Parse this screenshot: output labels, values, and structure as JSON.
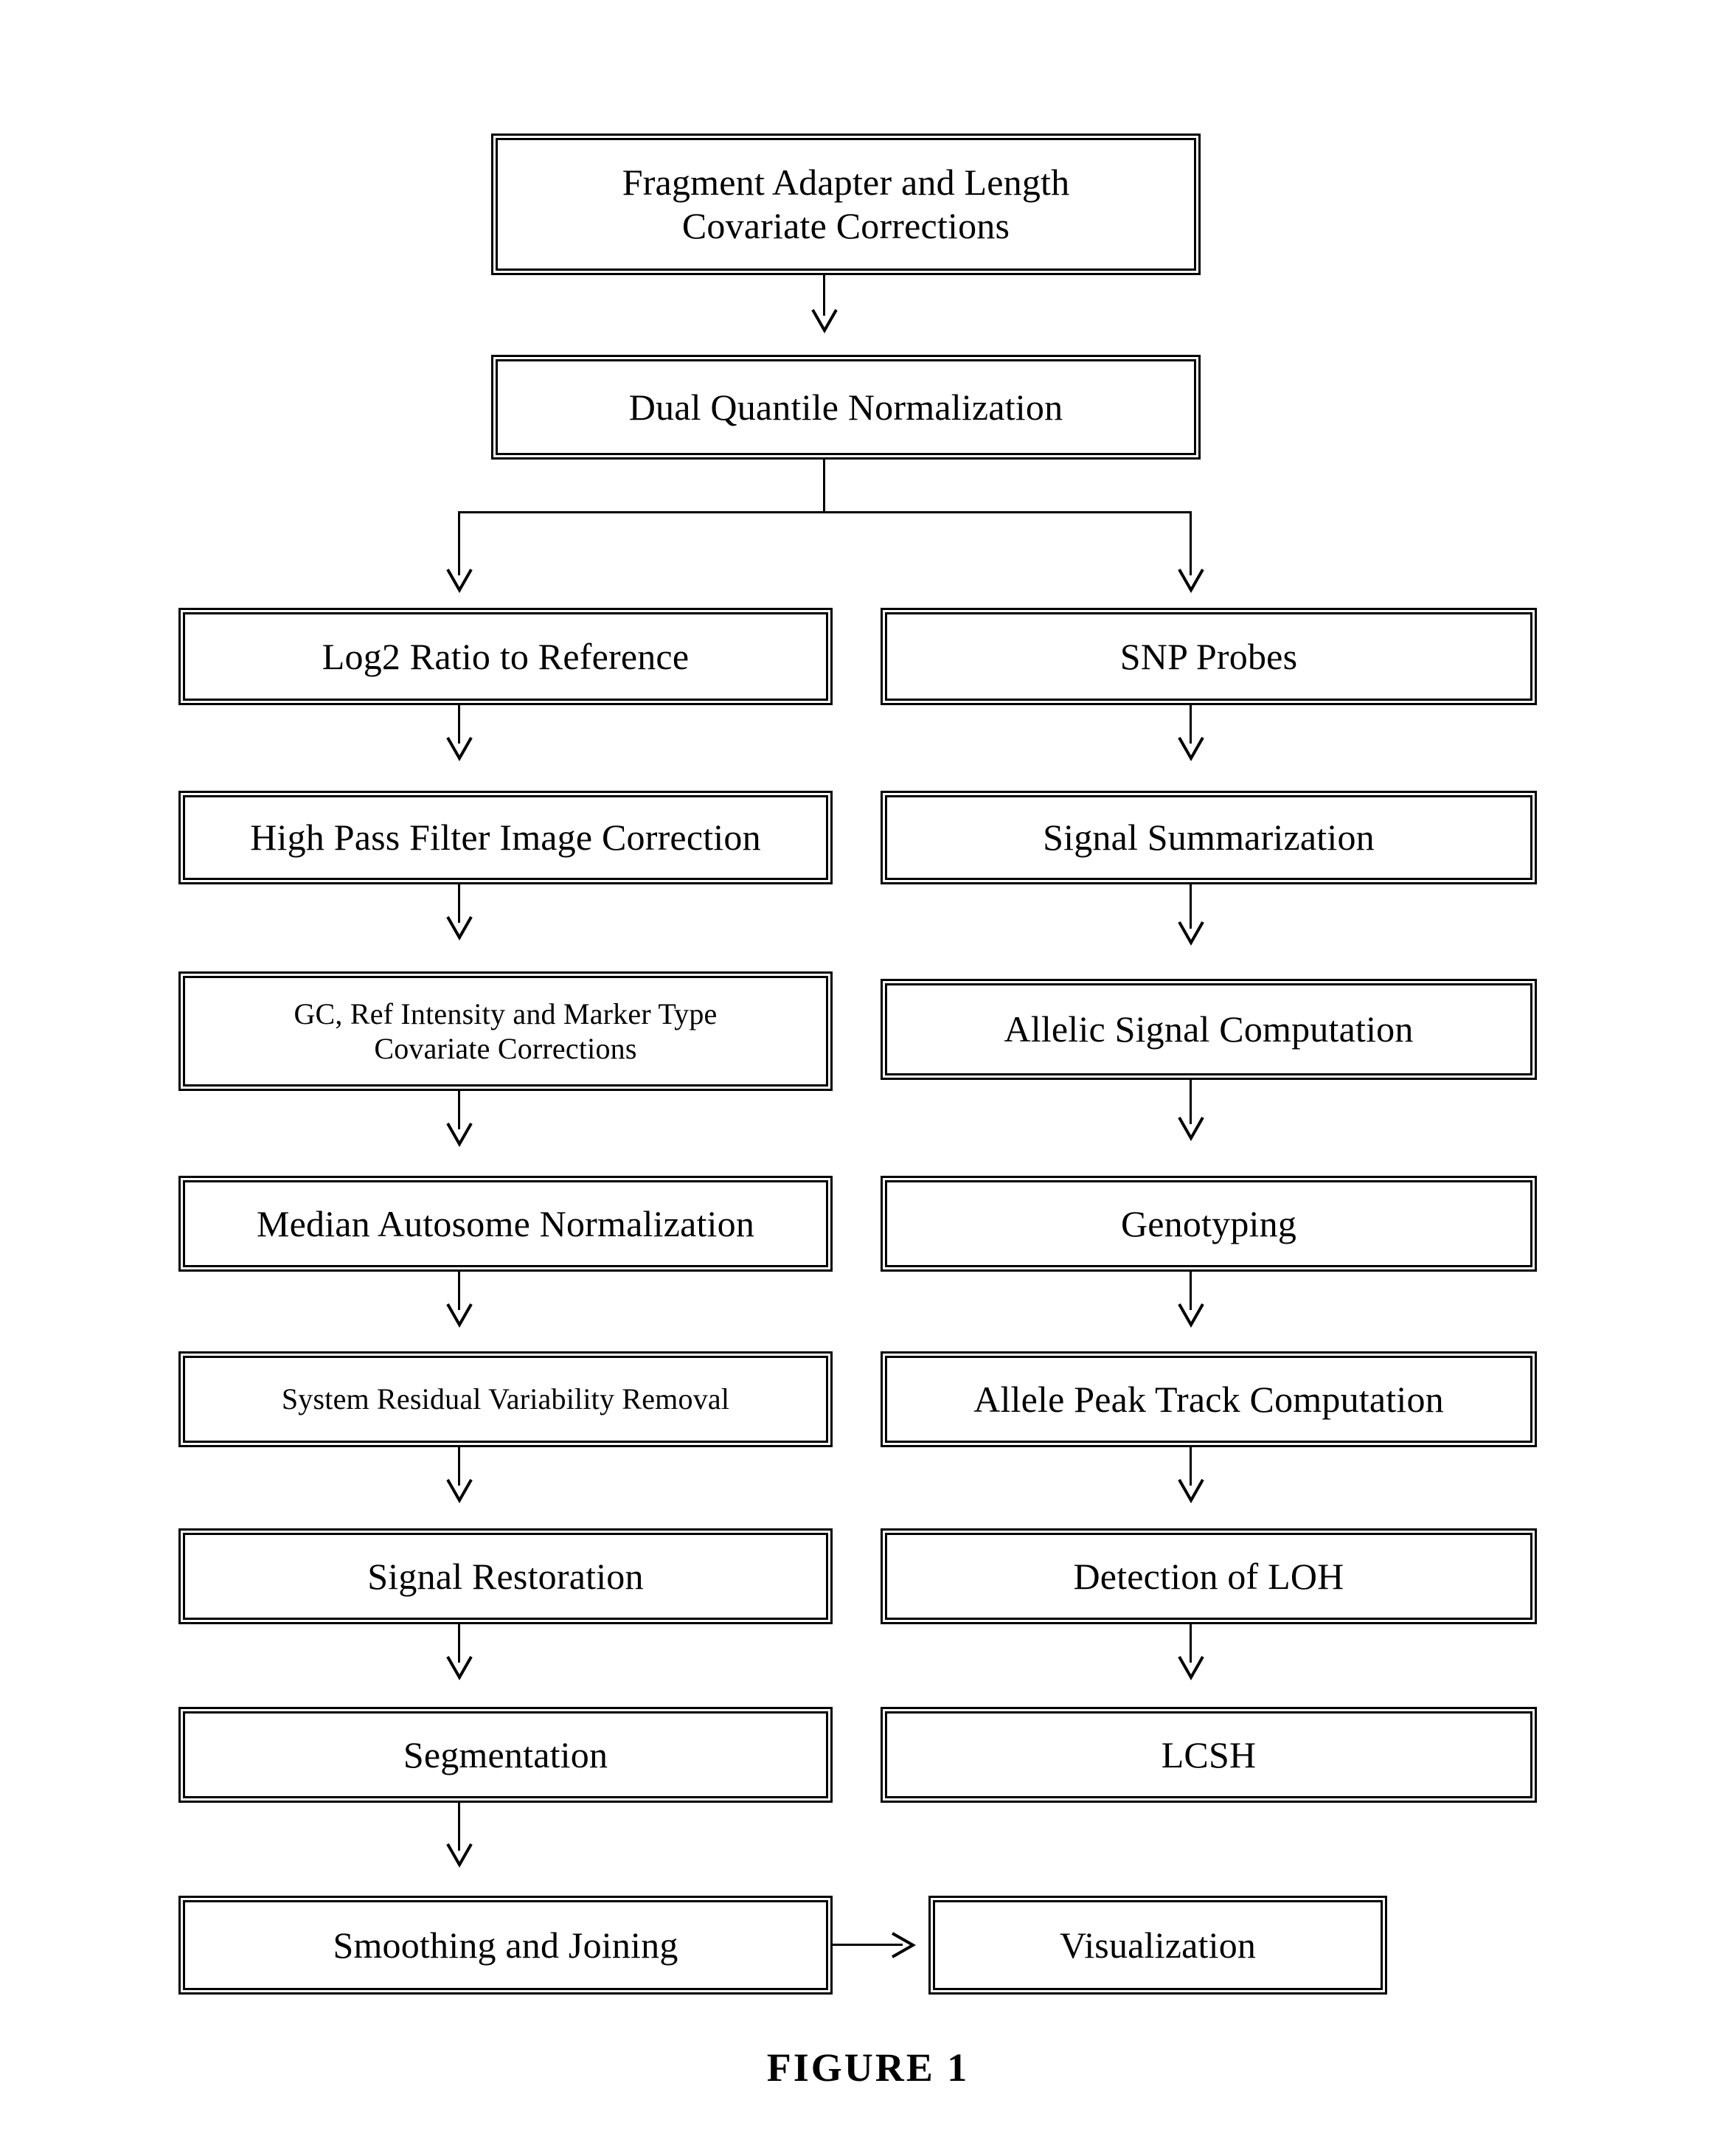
{
  "figure": {
    "caption": "FIGURE 1"
  },
  "diagram": {
    "type": "flowchart",
    "orientation": "top-to-bottom, two parallel branches",
    "nodes": {
      "fragment_adapter": "Fragment Adapter and Length\nCovariate Corrections",
      "dual_quantile": "Dual Quantile Normalization",
      "log2_ratio": "Log2 Ratio to Reference",
      "snp_probes": "SNP Probes",
      "high_pass_filter": "High Pass Filter Image Correction",
      "signal_summarization": "Signal Summarization",
      "gc_ref_intensity": "GC, Ref Intensity and Marker Type\nCovariate Corrections",
      "allelic_signal": "Allelic Signal Computation",
      "median_autosome": "Median Autosome Normalization",
      "genotyping": "Genotyping",
      "system_residual": "System Residual Variability Removal",
      "allele_peak_track": "Allele Peak Track Computation",
      "signal_restoration": "Signal Restoration",
      "detection_loh": "Detection of LOH",
      "segmentation": "Segmentation",
      "lcsh": "LCSH",
      "smoothing_joining": "Smoothing and Joining",
      "visualization": "Visualization"
    },
    "colors": {
      "stroke": "#000000",
      "fill": "#ffffff",
      "text": "#000000"
    }
  }
}
